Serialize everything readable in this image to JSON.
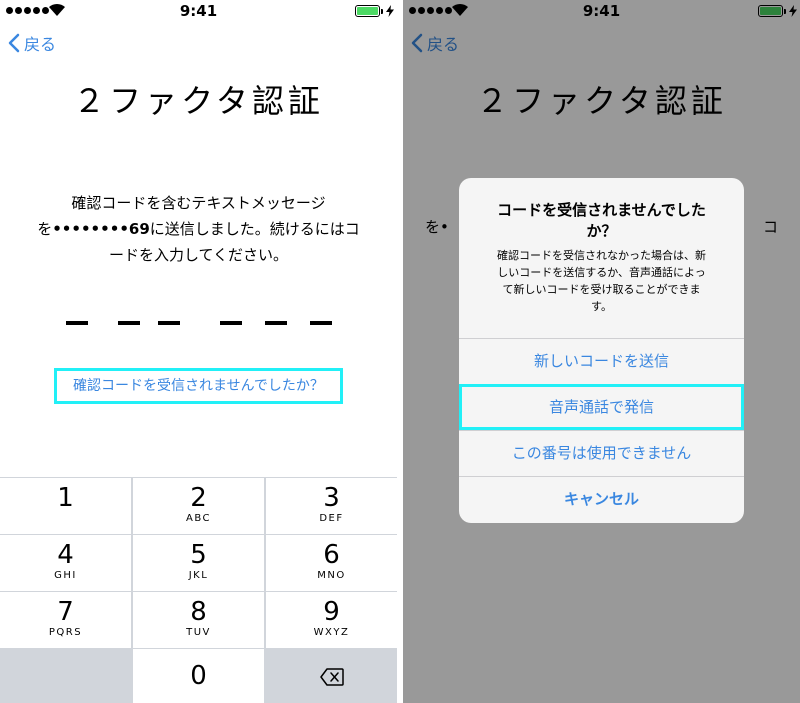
{
  "status": {
    "time": "9:41"
  },
  "nav": {
    "back_label": "戻る"
  },
  "page": {
    "title": "２ファクタ認証",
    "message_line1": "確認コードを含むテキストメッセージ",
    "message_line2_prefix": "を",
    "message_masked_number": "••••••••69",
    "message_line2_suffix": "に送信しました。続けるにはコ",
    "message_line3": "ードを入力してください。",
    "resend_link": "確認コードを受信されませんでしたか？",
    "right_partial_left": "を•",
    "right_partial_right": "コ"
  },
  "keypad": {
    "keys": [
      {
        "num": "1",
        "letters": ""
      },
      {
        "num": "2",
        "letters": "ABC"
      },
      {
        "num": "3",
        "letters": "DEF"
      },
      {
        "num": "4",
        "letters": "GHI"
      },
      {
        "num": "5",
        "letters": "JKL"
      },
      {
        "num": "6",
        "letters": "MNO"
      },
      {
        "num": "7",
        "letters": "PQRS"
      },
      {
        "num": "8",
        "letters": "TUV"
      },
      {
        "num": "9",
        "letters": "WXYZ"
      },
      {
        "num": "0",
        "letters": ""
      }
    ]
  },
  "alert": {
    "title_line1": "コードを受信されませんでした",
    "title_line2": "か？",
    "message_line1": "確認コードを受信されなかった場合は、新",
    "message_line2": "しいコードを送信するか、音声通話によっ",
    "message_line3": "て新しいコードを受け取ることができま",
    "message_line4": "す。",
    "buttons": {
      "send_new": "新しいコードを送信",
      "voice_call": "音声通話で発信",
      "unavailable": "この番号は使用できません",
      "cancel": "キャンセル"
    }
  },
  "colors": {
    "accent": "#3a87e0",
    "highlight": "#21f0f7",
    "battery": "#4cd964"
  }
}
